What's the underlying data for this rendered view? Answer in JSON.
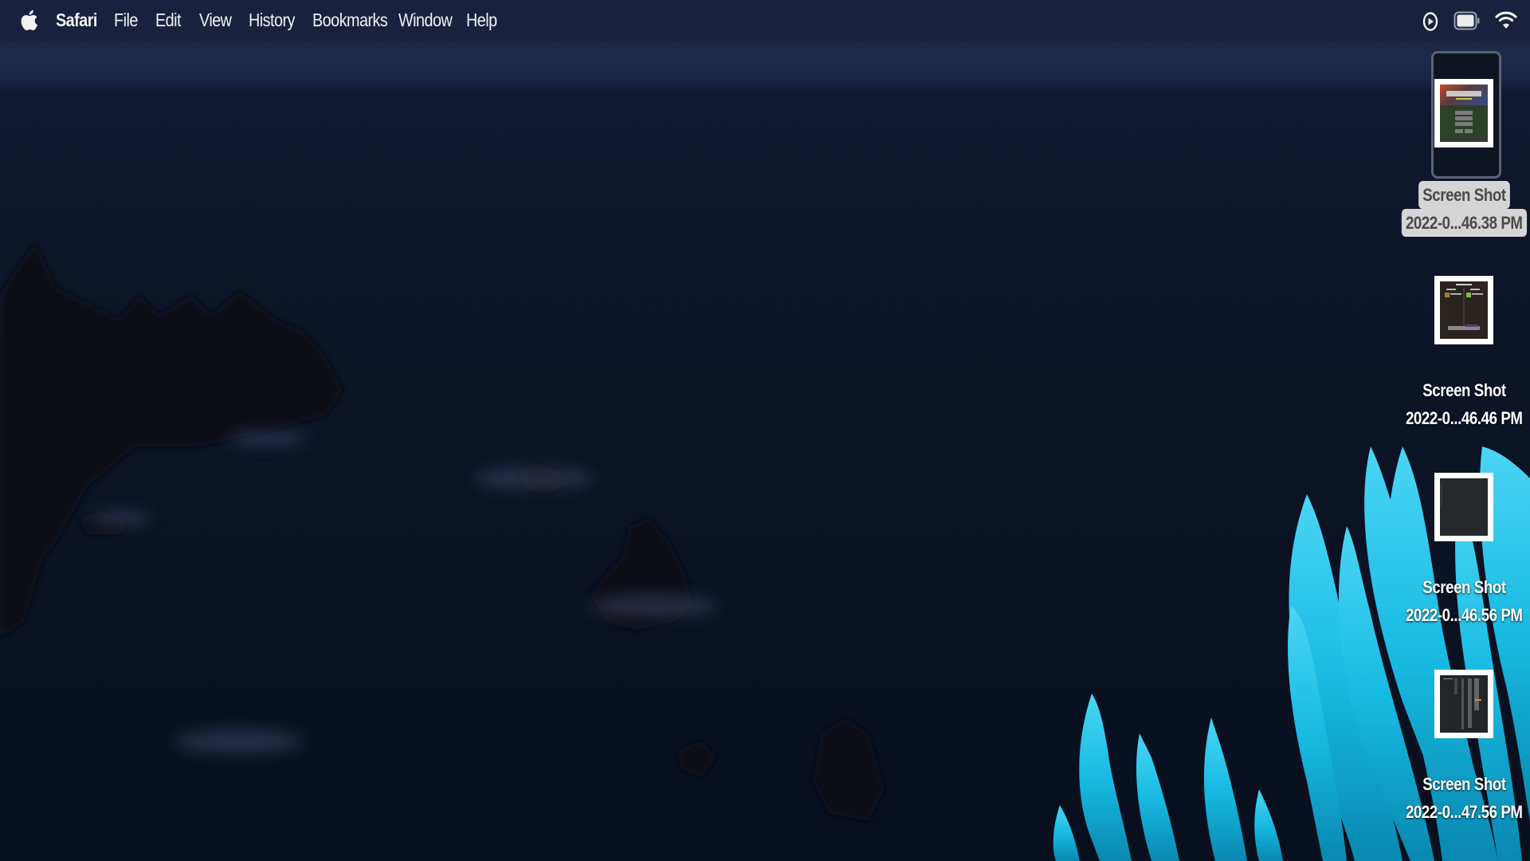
{
  "menubar": {
    "apple_icon": "apple-logo-icon",
    "app_name": "Safari",
    "items": [
      "File",
      "Edit",
      "View",
      "History",
      "Bookmarks",
      "Window",
      "Help"
    ],
    "status_icons": [
      "play-circle-icon",
      "battery-icon",
      "wifi-icon"
    ]
  },
  "desktop": {
    "icons": [
      {
        "line1": "Screen Shot",
        "line2": "2022-0...46.38 PM",
        "thumbnail": "minecraft-title-screen",
        "selected": true
      },
      {
        "line1": "Screen Shot",
        "line2": "2022-0...46.46 PM",
        "thumbnail": "minecraft-menu-screen",
        "selected": false
      },
      {
        "line1": "Screen Shot",
        "line2": "2022-0...46.56 PM",
        "thumbnail": "dark-blank-screen",
        "selected": false
      },
      {
        "line1": "Screen Shot",
        "line2": "2022-0...47.56 PM",
        "thumbnail": "terminal-list-screen",
        "selected": false
      }
    ]
  },
  "colors": {
    "menubar_bg": "#19213f",
    "wallpaper_sky": "#1f2a4b",
    "wallpaper_sea": "#0b1325",
    "grass_accent": "#1ec8f0",
    "selection_label_bg": "#d5d5d5"
  }
}
